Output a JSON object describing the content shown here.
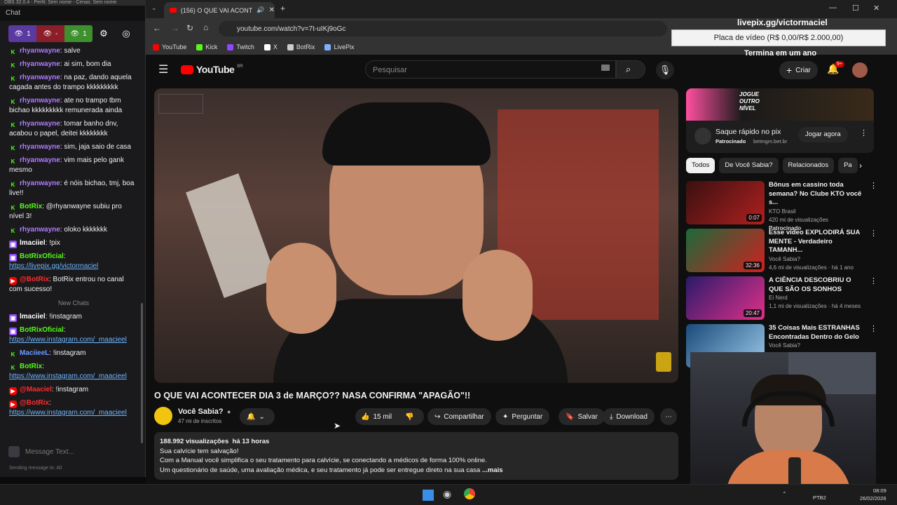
{
  "obs_title": "OBS 32.0.4 - Perfil: Sem nome - Cenas: Sem nome",
  "chat": {
    "header": "Chat",
    "tools": {
      "viewers1": "1",
      "viewers2": "-",
      "viewers3": "1"
    },
    "messages": [
      {
        "platform": "kick",
        "user": "rhyanwayne",
        "color": "#b07cff",
        "text": ": salve"
      },
      {
        "platform": "kick",
        "user": "rhyanwayne",
        "color": "#b07cff",
        "text": ": ai sim, bom dia"
      },
      {
        "platform": "kick",
        "user": "rhyanwayne",
        "color": "#b07cff",
        "text": ": na paz, dando aquela cagada antes do trampo kkkkkkkkk"
      },
      {
        "platform": "kick",
        "user": "rhyanwayne",
        "color": "#b07cff",
        "text": ": ate no trampo tbm bichao kkkkkkkkk remunerada ainda"
      },
      {
        "platform": "kick",
        "user": "rhyanwayne",
        "color": "#b07cff",
        "text": ": tomar banho dnv, acabou o papel, deitei kkkkkkkk"
      },
      {
        "platform": "kick",
        "user": "rhyanwayne",
        "color": "#b07cff",
        "text": ": sim, jaja saio de casa"
      },
      {
        "platform": "kick",
        "user": "rhyanwayne",
        "color": "#b07cff",
        "text": ": vim mais pelo gank mesmo"
      },
      {
        "platform": "kick",
        "user": "rhyanwayne",
        "color": "#b07cff",
        "text": ": é nóis bichao, tmj, boa live!!"
      },
      {
        "platform": "kick",
        "user": "BotRix",
        "color": "#53fc18",
        "text": ": @rhyanwayne subiu pro nível 3!"
      },
      {
        "platform": "kick",
        "user": "rhyanwayne",
        "color": "#b07cff",
        "text": ": oloko kkkkkkk"
      },
      {
        "platform": "twitch",
        "user": "lmaciiel",
        "color": "#ffffff",
        "text": ": !pix"
      },
      {
        "platform": "twitch",
        "user": "BotRixOficial",
        "color": "#53fc18",
        "text": ":",
        "link": "https://livepix.gg/victormaciel"
      },
      {
        "platform": "youtube",
        "user": "@BotRix",
        "color": "#ff2b2b",
        "text": ": BotRix entrou no canal com sucesso!"
      }
    ],
    "separator": "New Chats",
    "new_messages": [
      {
        "platform": "twitch",
        "user": "lmaciiel",
        "color": "#ffffff",
        "text": ": !instagram"
      },
      {
        "platform": "twitch",
        "user": "BotRixOficial",
        "color": "#53fc18",
        "text": ":",
        "link": "https://www.instagram.com/_maacieel"
      },
      {
        "platform": "kick",
        "user": "MaciieeL",
        "color": "#6d9bff",
        "text": ": !instagram"
      },
      {
        "platform": "kick",
        "user": "BotRix",
        "color": "#53fc18",
        "text": ":",
        "link": "https://www.instagram.com/_maacieel"
      },
      {
        "platform": "youtube",
        "user": "@Maaciel",
        "color": "#ff2b2b",
        "text": ": !instagram"
      },
      {
        "platform": "youtube",
        "user": "@BotRix",
        "color": "#ff2b2b",
        "text": ":",
        "link": "https://www.instagram.com/_maacieel"
      }
    ],
    "input_placeholder": "Message Text...",
    "sending_to": "Sending message to: All"
  },
  "browser": {
    "tab_title": "(156) O QUE VAI ACONTEC",
    "url": "youtube.com/watch?v=7t-uIKj9oGc",
    "bookmarks": [
      {
        "label": "YouTube",
        "color": "#ff0000"
      },
      {
        "label": "Kick",
        "color": "#53fc18"
      },
      {
        "label": "Twitch",
        "color": "#9146ff"
      },
      {
        "label": "X",
        "color": "#ffffff"
      },
      {
        "label": "BotRix",
        "color": "#cccccc"
      },
      {
        "label": "LivePix",
        "color": "#7fb0ff"
      }
    ]
  },
  "youtube": {
    "logo": "YouTube",
    "logo_region": "BR",
    "search_placeholder": "Pesquisar",
    "create_label": "Criar",
    "notif_count": "9+",
    "video_title": "O QUE VAI ACONTECER DIA 3 de MARÇO?? NASA CONFIRMA \"APAGÃO\"!!",
    "channel": "Você Sabia?",
    "subscribers": "47 mi de inscritos",
    "likes": "15 mil",
    "share": "Compartilhar",
    "ask": "Perguntar",
    "save": "Salvar",
    "download": "Download",
    "views": "188.992 visualizações",
    "age": "há 13 horas",
    "desc_line1": "Sua calvície tem salvação!",
    "desc_line2": "Com a Manual você simplifica o seu tratamento para calvície, se conectando a médicos de forma 100% online.",
    "desc_line3": "Um questionário de saúde, uma avaliação médica, e seu tratamento já pode ser entregue direto na sua casa",
    "more": "...mais",
    "ad": {
      "banner1": "JOGUE",
      "banner2": "OUTRO",
      "banner3": "NÍVEL",
      "title": "Saque rápido no pix",
      "sponsored": "Patrocinado",
      "domain": "betmgm.bet.br",
      "cta": "Jogar agora"
    },
    "chips": [
      "Todos",
      "De Você Sabia?",
      "Relacionados",
      "Pa"
    ],
    "recs": [
      {
        "title": "Bônus em cassino toda semana? No Clube KTO você s...",
        "channel": "KTO Brasil",
        "meta": "420 mi de visualizações",
        "extra": "Patrocinado",
        "duration": "0:07",
        "c1": "#3a1010",
        "c2": "#b02020"
      },
      {
        "title": "Esse vídeo EXPLODIRÁ SUA MENTE - Verdadeiro TAMANH...",
        "channel": "Você Sabia?",
        "meta": "4,6 mi de visualizações · há 1 ano",
        "extra": "",
        "duration": "32:36",
        "c1": "#1a6a3a",
        "c2": "#d02020"
      },
      {
        "title": "A CIÊNCIA DESCOBRIU O QUE SÃO OS SONHOS",
        "channel": "Ei Nerd",
        "meta": "1,1 mi de visualizações · há 4 meses",
        "extra": "",
        "duration": "20:47",
        "c1": "#2a1a6a",
        "c2": "#e0308a"
      },
      {
        "title": "35 Coisas Mais ESTRANHAS Encontradas Dentro do Gelo",
        "channel": "Você Sabia?",
        "meta": "",
        "extra": "",
        "duration": "",
        "c1": "#1a4a7a",
        "c2": "#9ac8e8"
      }
    ]
  },
  "overlay": {
    "pix_title": "livepix.gg/victormaciel",
    "goal": "Placa de vídeo (R$ 0,00/R$ 2.000,00)",
    "footer": "Termina em um ano"
  },
  "taskbar": {
    "lang": "PTB2",
    "time": "08:09",
    "date": "26/02/2026"
  }
}
